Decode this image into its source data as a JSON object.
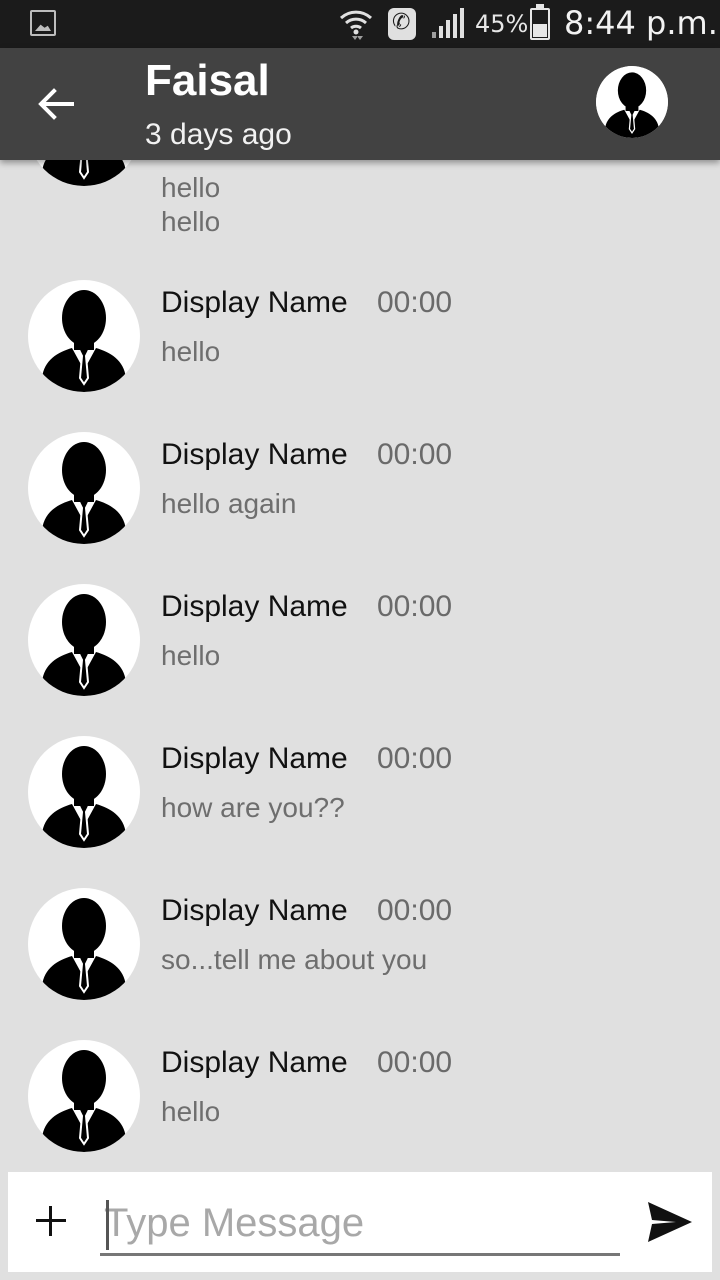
{
  "status_bar": {
    "battery_percent": "45%",
    "battery_level": 0.45,
    "time": "8:44 p.m.",
    "icons": [
      "gallery-icon",
      "wifi-icon",
      "call-icon",
      "signal-icon",
      "battery-icon"
    ]
  },
  "header": {
    "title": "Faisal",
    "subtitle": "3 days ago"
  },
  "partial_message": {
    "lines": [
      "hello",
      "hello"
    ]
  },
  "messages": [
    {
      "name": "Display Name",
      "time": "00:00",
      "text": "hello"
    },
    {
      "name": "Display Name",
      "time": "00:00",
      "text": "hello again"
    },
    {
      "name": "Display Name",
      "time": "00:00",
      "text": "hello"
    },
    {
      "name": "Display Name",
      "time": "00:00",
      "text": "how are you??"
    },
    {
      "name": "Display Name",
      "time": "00:00",
      "text": "so...tell me about you"
    },
    {
      "name": "Display Name",
      "time": "00:00",
      "text": "hello"
    }
  ],
  "composer": {
    "placeholder": "Type Message",
    "value": ""
  },
  "colors": {
    "app_bar": "#424242",
    "status_bar": "#1b1b1b",
    "background": "#e0e0e0"
  }
}
